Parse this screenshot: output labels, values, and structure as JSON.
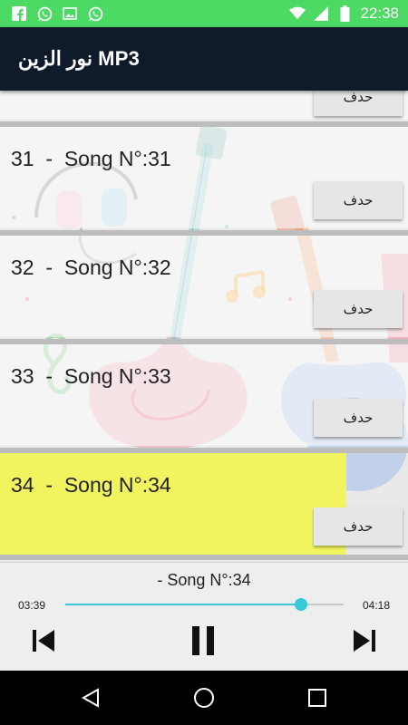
{
  "status_bar": {
    "time": "22:38",
    "left_icons": [
      "facebook-icon",
      "whatsapp-icon",
      "image-icon",
      "whatsapp-icon"
    ],
    "right_icons": [
      "wifi-icon",
      "signal-icon",
      "battery-icon"
    ]
  },
  "app_bar": {
    "title": "نور الزين MP3",
    "background": "#0f1a2b"
  },
  "songs": [
    {
      "number": "",
      "label": "",
      "delete_label": "حدف",
      "active": false
    },
    {
      "number": "31",
      "label": "  -  Song N°:31",
      "delete_label": "حدف",
      "active": false
    },
    {
      "number": "32",
      "label": "  -  Song N°:32",
      "delete_label": "حدف",
      "active": false
    },
    {
      "number": "33",
      "label": "  -  Song N°:33",
      "delete_label": "حدف",
      "active": false
    },
    {
      "number": "34",
      "label": "  -  Song N°:34",
      "delete_label": "حدف",
      "active": true
    }
  ],
  "player": {
    "now_playing": "-  Song N°:34",
    "current_time": "03:39",
    "total_time": "04:18",
    "progress_fraction": 0.848,
    "accent": "#38c9d9",
    "highlight": "#f1f45e"
  },
  "nav_bar": {
    "buttons": [
      "back-icon",
      "home-icon",
      "recents-icon"
    ]
  }
}
